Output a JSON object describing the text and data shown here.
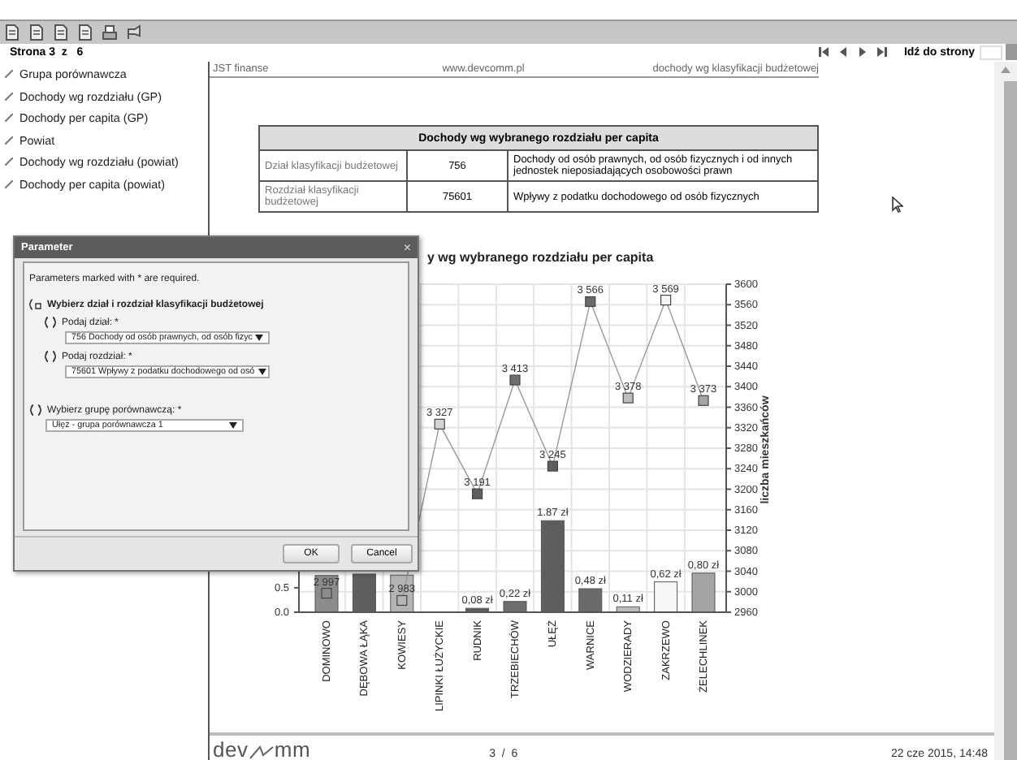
{
  "pager": {
    "label": "Strona 3",
    "separator": "z",
    "total": "6",
    "goto_label": "Idź do strony"
  },
  "sidebar": {
    "items": [
      {
        "label": "Grupa porównawcza"
      },
      {
        "label": "Dochody wg rozdziału (GP)"
      },
      {
        "label": "Dochody per capita (GP)"
      },
      {
        "label": "Powiat"
      },
      {
        "label": "Dochody wg rozdziału (powiat)"
      },
      {
        "label": "Dochody per capita (powiat)"
      }
    ]
  },
  "report": {
    "header": {
      "left": "JST finanse",
      "center": "www.devcomm.pl",
      "right": "dochody wg klasyfikacji budżetowej"
    },
    "table": {
      "title": "Dochody wg wybranego rozdziału per capita",
      "rows": [
        {
          "label": "Dział klasyfikacji budżetowej",
          "code": "756",
          "description": "Dochody od osób prawnych, od osób fizycznych i od innych jednostek nieposiadających osobowości prawn"
        },
        {
          "label": "Rozdział klasyfikacji budżetowej",
          "code": "75601",
          "description": "Wpływy z podatku dochodowego od osób fizycznych"
        }
      ]
    },
    "chart": {
      "chart_data": {
        "type": "bar",
        "title": "y wg wybranego rozdziału per capita",
        "categories": [
          "DOMINOWO",
          "DĘBOWA ŁĄKA",
          "KOWIESY",
          "LIPINKI ŁUŻYCKIE",
          "RUDNIK",
          "TRZEBIECHÓW",
          "UŁĘŻ",
          "WARNICE",
          "WODZIERADY",
          "ZAKRZEWO",
          "ŻELECHLINEK"
        ],
        "series": [
          {
            "type": "bar",
            "values": [
              0.75,
              0.78,
              0.76,
              null,
              0.08,
              0.22,
              1.87,
              0.48,
              0.11,
              0.62,
              0.8
            ],
            "colors": [
              "#8c8c8c",
              "#5e5e5e",
              "#b4b4b4",
              null,
              "#5e5e5e",
              "#6e6e6e",
              "#5e5e5e",
              "#6a6a6a",
              "#bcbcbc",
              "#f6f6f6",
              "#a4a4a4"
            ],
            "value_labels": [
              null,
              null,
              null,
              null,
              "0,08 zł",
              "0,22 zł",
              "1.87 zł",
              "0,48 zł",
              "0,11 zł",
              "0,62 zł",
              "0,80 zł"
            ]
          },
          {
            "type": "line",
            "axis": "y2",
            "marker": "square",
            "values": [
              2997,
              null,
              2983,
              3327,
              3191,
              3413,
              3245,
              3566,
              3378,
              3569,
              3373
            ],
            "colors": [
              "#8c8c8c",
              null,
              "#b4b4b4",
              "#d4d4d4",
              "#5e5e5e",
              "#6e6e6e",
              "#5e5e5e",
              "#6a6a6a",
              "#bcbcbc",
              "#f6f6f6",
              "#a4a4a4"
            ],
            "value_labels": [
              "2 997",
              null,
              "2 983",
              "3 327",
              "3 191",
              "3 413",
              "3 245",
              "3 566",
              "3 378",
              "3 569",
              "3 373"
            ]
          }
        ],
        "grid": true,
        "ylim": [
          0,
          6.7
        ],
        "yticks": [
          {
            "value": 0,
            "label": "0.0"
          },
          {
            "value": 0.5,
            "label": "0.5"
          }
        ],
        "y2label": "liczba mieszkańców",
        "y2lim": [
          2960,
          3600
        ],
        "y2ticks": [
          2960,
          3000,
          3040,
          3080,
          3120,
          3160,
          3200,
          3240,
          3280,
          3320,
          3360,
          3400,
          3440,
          3480,
          3520,
          3560,
          3600
        ]
      }
    },
    "footer": {
      "logo_left": "dev",
      "logo_right": "mm",
      "page": "3  /  6",
      "date": "22 cze 2015, 14:48"
    }
  },
  "dialog": {
    "title": "Parameter",
    "close": "×",
    "note": "Parameters marked with * are required.",
    "group": {
      "label": "Wybierz dział i rozdział klasyfikacji budżetowej",
      "fields": [
        {
          "label": "Podaj dział: *",
          "value": "756 Dochody od osób prawnych, od osób fizyc"
        },
        {
          "label": "Podaj rozdział: *",
          "value": "75601 Wpływy z podatku dochodowego od osó"
        }
      ]
    },
    "fields": [
      {
        "label": "Wybierz grupę porównawczą: *",
        "value": "Ułęż - grupa porównawcza 1"
      }
    ],
    "buttons": [
      "OK",
      "Cancel"
    ]
  }
}
